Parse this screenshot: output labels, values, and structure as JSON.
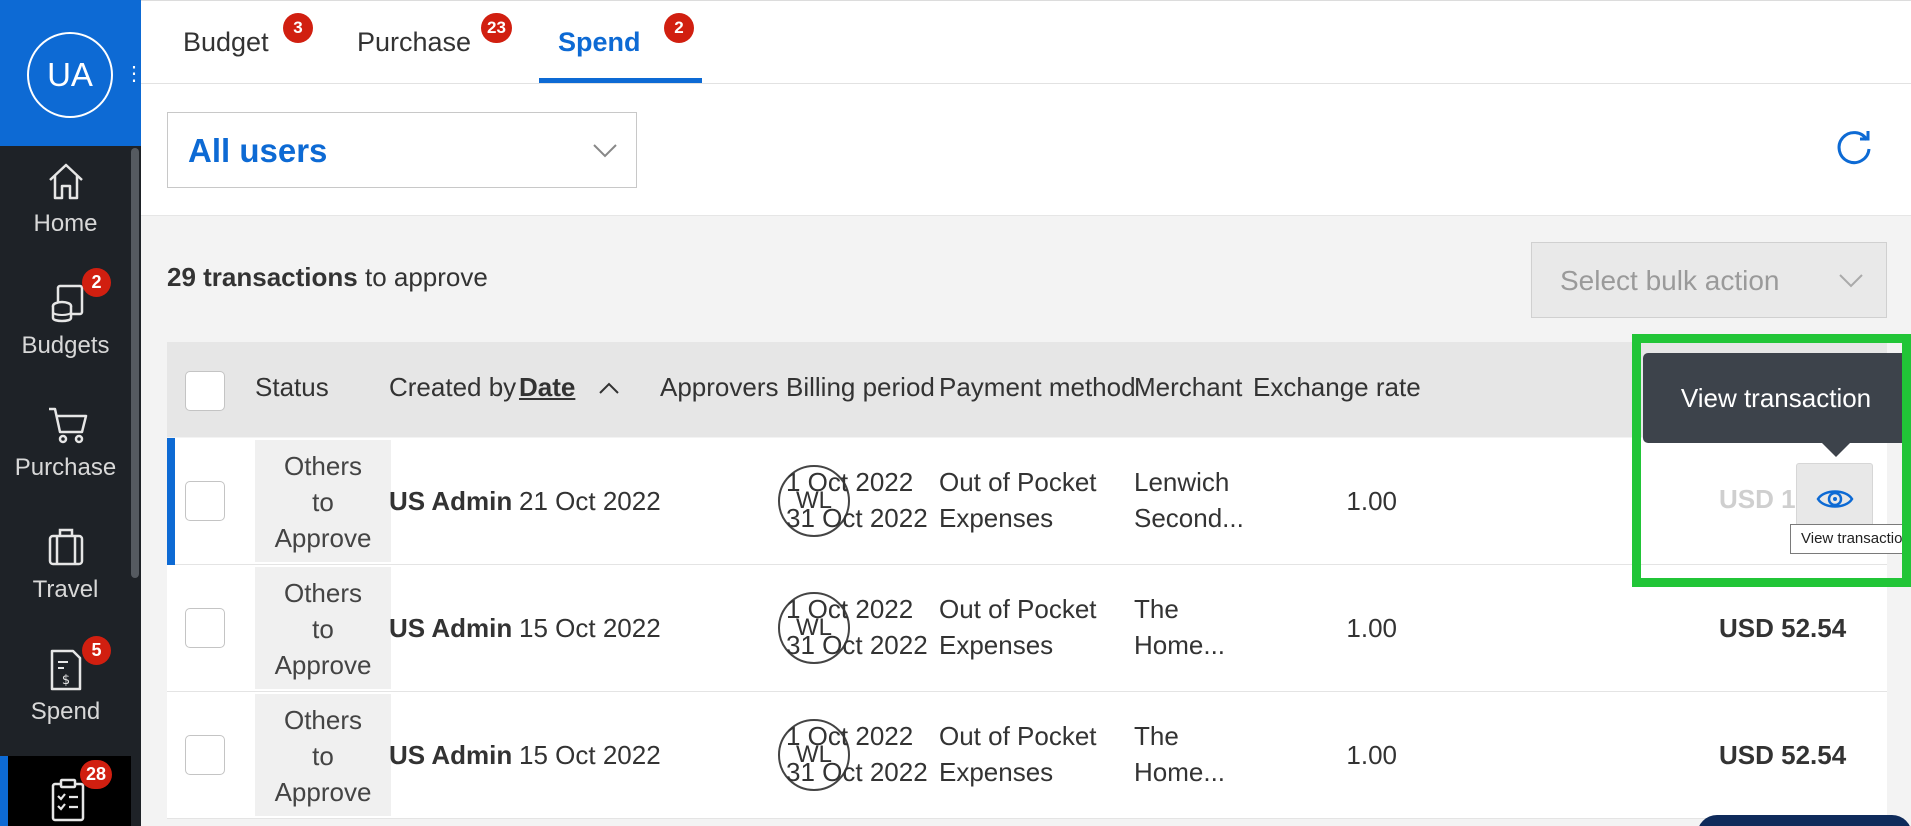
{
  "colors": {
    "brand": "#0d6ad4",
    "badge": "#d11f10",
    "sidebar": "#1e2227",
    "highlight": "#21c537",
    "tooltip": "#3d434b"
  },
  "sidebar": {
    "avatar": "UA",
    "items": [
      {
        "label": "Home",
        "icon": "home-icon",
        "badge": ""
      },
      {
        "label": "Budgets",
        "icon": "budgets-icon",
        "badge": "2"
      },
      {
        "label": "Purchase",
        "icon": "cart-icon",
        "badge": ""
      },
      {
        "label": "Travel",
        "icon": "luggage-icon",
        "badge": ""
      },
      {
        "label": "Spend",
        "icon": "receipt-icon",
        "badge": "5"
      },
      {
        "label": "",
        "icon": "clipboard-check-icon",
        "badge": "28"
      }
    ]
  },
  "tabs": [
    {
      "label": "Budget",
      "badge": "3"
    },
    {
      "label": "Purchase",
      "badge": "23"
    },
    {
      "label": "Spend",
      "badge": "2",
      "active": true
    }
  ],
  "filter": {
    "user_select": "All users"
  },
  "summary": {
    "count": "29 transactions",
    "suffix": " to approve"
  },
  "bulk_action": {
    "placeholder": "Select bulk action"
  },
  "table": {
    "columns": [
      "Status",
      "Created by",
      "Date",
      "Approvers",
      "Billing period",
      "Payment method",
      "Merchant",
      "Exchange rate"
    ],
    "sorted_column": "Date",
    "rows": [
      {
        "status": [
          "Others",
          "to",
          "Approve"
        ],
        "created_by": "US Admin",
        "date": "21 Oct 2022",
        "approver": "WL",
        "billing": [
          "1 Oct 2022",
          "31 Oct 2022"
        ],
        "payment": [
          "Out of Pocket",
          "Expenses"
        ],
        "merchant": [
          "Lenwich",
          "Second..."
        ],
        "rate": "1.00",
        "amount": "USD 1"
      },
      {
        "status": [
          "Others",
          "to",
          "Approve"
        ],
        "created_by": "US Admin",
        "date": "15 Oct 2022",
        "approver": "WL",
        "billing": [
          "1 Oct 2022",
          "31 Oct 2022"
        ],
        "payment": [
          "Out of Pocket",
          "Expenses"
        ],
        "merchant": [
          "The",
          "Home..."
        ],
        "rate": "1.00",
        "amount": "USD 52.54"
      },
      {
        "status": [
          "Others",
          "to",
          "Approve"
        ],
        "created_by": "US Admin",
        "date": "15 Oct 2022",
        "approver": "WL",
        "billing": [
          "1 Oct 2022",
          "31 Oct 2022"
        ],
        "payment": [
          "Out of Pocket",
          "Expenses"
        ],
        "merchant": [
          "The",
          "Home..."
        ],
        "rate": "1.00",
        "amount": "USD 52.54"
      }
    ]
  },
  "tooltip": {
    "text": "View transaction",
    "mini": "View transaction"
  }
}
